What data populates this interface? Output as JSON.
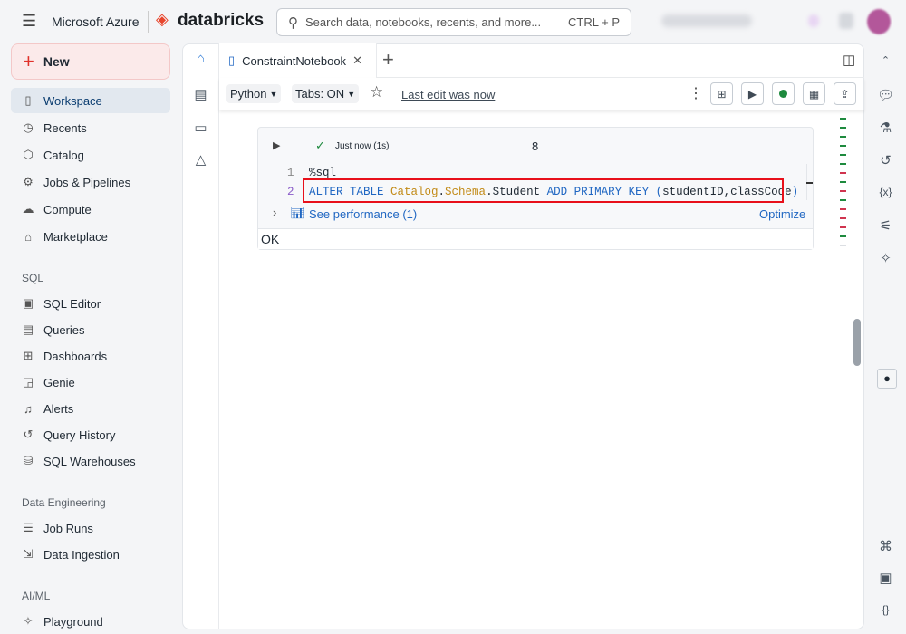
{
  "topbar": {
    "brand_ms": "Microsoft Azure",
    "brand_db": "databricks",
    "search_placeholder": "Search data, notebooks, recents, and more...",
    "search_shortcut": "CTRL + P"
  },
  "sidebar": {
    "new_label": "New",
    "items": [
      {
        "label": "Workspace",
        "icon": "notebook-icon"
      },
      {
        "label": "Recents",
        "icon": "clock-icon"
      },
      {
        "label": "Catalog",
        "icon": "catalog-icon"
      },
      {
        "label": "Jobs & Pipelines",
        "icon": "jobs-icon"
      },
      {
        "label": "Compute",
        "icon": "cloud-icon"
      },
      {
        "label": "Marketplace",
        "icon": "store-icon"
      }
    ],
    "sql_header": "SQL",
    "sql_items": [
      {
        "label": "SQL Editor"
      },
      {
        "label": "Queries"
      },
      {
        "label": "Dashboards"
      },
      {
        "label": "Genie"
      },
      {
        "label": "Alerts"
      },
      {
        "label": "Query History"
      },
      {
        "label": "SQL Warehouses"
      }
    ],
    "de_header": "Data Engineering",
    "de_items": [
      {
        "label": "Job Runs"
      },
      {
        "label": "Data Ingestion"
      }
    ],
    "ai_header": "AI/ML",
    "ai_items": [
      {
        "label": "Playground"
      }
    ]
  },
  "tabs": [
    {
      "label": "ConstraintNotebook"
    }
  ],
  "toolbar": {
    "language": "Python",
    "tabs_setting": "Tabs: ON",
    "last_edit": "Last edit was now"
  },
  "cell": {
    "status": "Just now (1s)",
    "cell_number": "8",
    "lines": [
      {
        "n": "1",
        "text": "%sql"
      },
      {
        "n": "2",
        "kw1": "ALTER TABLE ",
        "id1": "Catalog",
        "dot1": ".",
        "id2": "Schema",
        "rest": ".Student ",
        "kw2": "ADD PRIMARY KEY ",
        "paren_open": "(",
        "args": "studentID,classCode",
        "paren_close": ")"
      }
    ],
    "performance": "See performance (1)",
    "optimize": "Optimize",
    "output": "OK"
  },
  "colors": {
    "accent": "#1f66c2",
    "highlight_box": "#e8101a",
    "success": "#1e8a3e",
    "error_mark": "#d0344f"
  }
}
